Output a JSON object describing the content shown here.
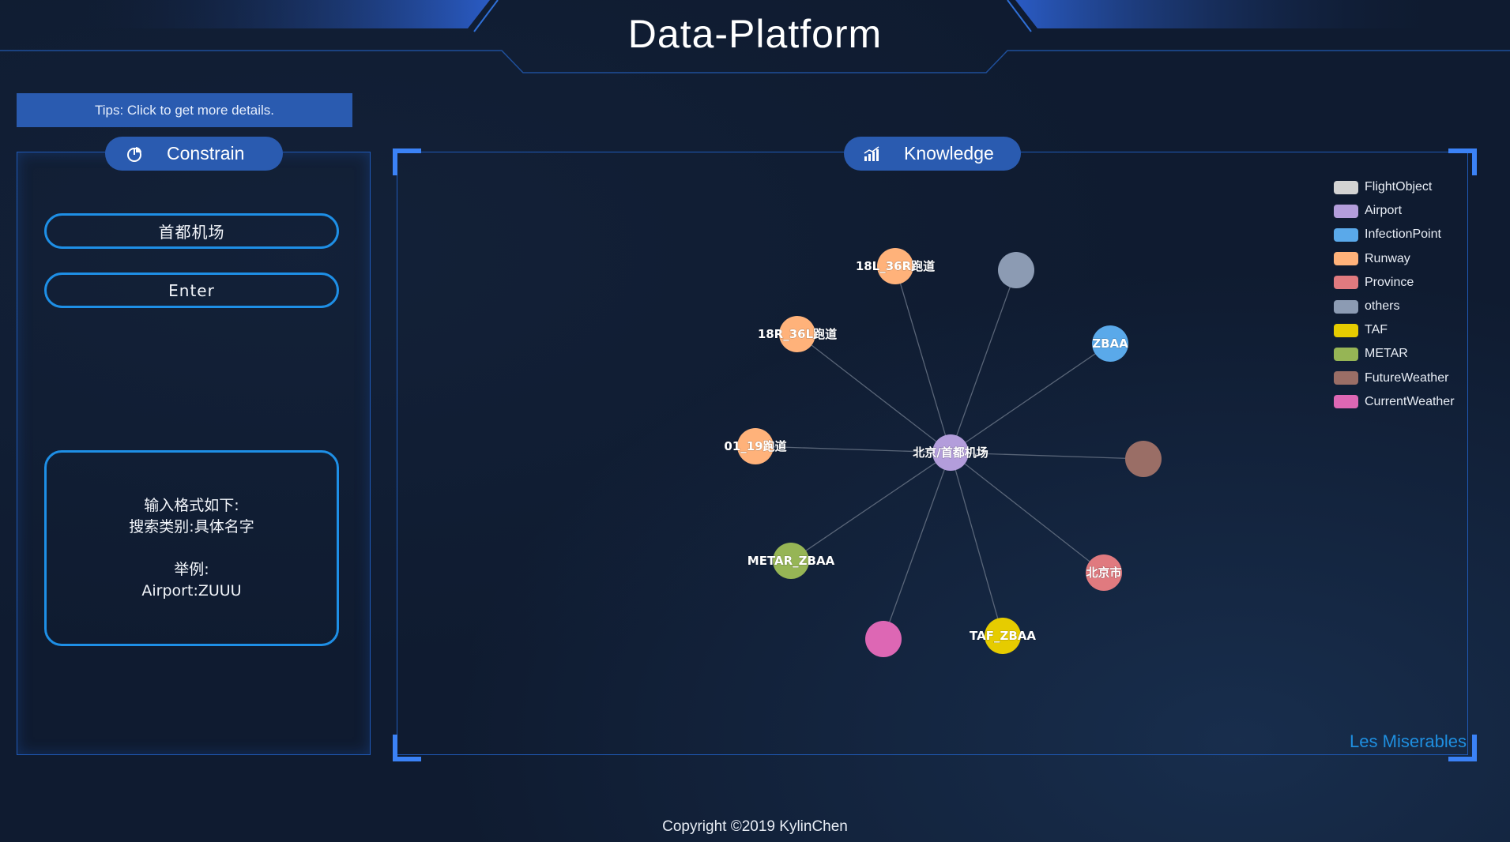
{
  "header": {
    "title": "Data-Platform"
  },
  "tips": {
    "text": "Tips: Click to get more details."
  },
  "constrain_panel": {
    "title": "Constrain",
    "icon": "pie-chart-icon",
    "search_value": "首都机场",
    "enter_label": "Enter",
    "help_lines": [
      "输入格式如下:",
      "搜索类别:具体名字",
      "",
      "举例:",
      "Airport:ZUUU"
    ]
  },
  "knowledge_panel": {
    "title": "Knowledge",
    "icon": "bar-chart-icon",
    "caption": "Les Miserables"
  },
  "legend": [
    {
      "label": "FlightObject",
      "color": "#d3d3d3"
    },
    {
      "label": "Airport",
      "color": "#b39ddb"
    },
    {
      "label": "InfectionPoint",
      "color": "#5aa9ea"
    },
    {
      "label": "Runway",
      "color": "#ffb27a"
    },
    {
      "label": "Province",
      "color": "#e07a7f"
    },
    {
      "label": "others",
      "color": "#8c9bb3"
    },
    {
      "label": "TAF",
      "color": "#e6cc00"
    },
    {
      "label": "METAR",
      "color": "#96b555"
    },
    {
      "label": "FutureWeather",
      "color": "#9a6e66"
    },
    {
      "label": "CurrentWeather",
      "color": "#dd67b4"
    }
  ],
  "graph": {
    "center": {
      "label": "北京/首都机场",
      "category": "Airport"
    },
    "nodes": [
      {
        "label": "18L_36R跑道",
        "category": "Runway"
      },
      {
        "label": "",
        "category": "others"
      },
      {
        "label": "ZBAA",
        "category": "InfectionPoint"
      },
      {
        "label": "",
        "category": "FutureWeather"
      },
      {
        "label": "北京市",
        "category": "Province"
      },
      {
        "label": "TAF_ZBAA",
        "category": "TAF"
      },
      {
        "label": "",
        "category": "CurrentWeather"
      },
      {
        "label": "METAR_ZBAA",
        "category": "METAR"
      },
      {
        "label": "01_19跑道",
        "category": "Runway"
      },
      {
        "label": "18R_36L跑道",
        "category": "Runway"
      }
    ]
  },
  "footer": {
    "copyright": "Copyright ©2019 KylinChen"
  }
}
